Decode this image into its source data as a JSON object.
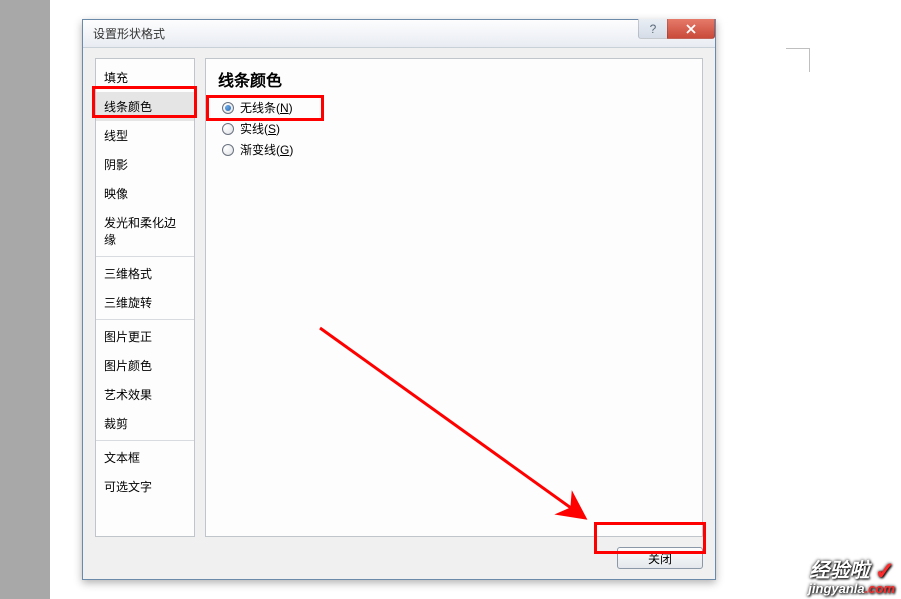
{
  "window": {
    "title": "设置形状格式"
  },
  "sidebar": {
    "items": [
      "填充",
      "线条颜色",
      "线型",
      "阴影",
      "映像",
      "发光和柔化边缘",
      "三维格式",
      "三维旋转",
      "图片更正",
      "图片颜色",
      "艺术效果",
      "裁剪",
      "文本框",
      "可选文字"
    ],
    "selected_index": 1,
    "separators_after": [
      5,
      7,
      11
    ]
  },
  "content": {
    "title": "线条颜色",
    "radios": [
      {
        "label": "无线条",
        "accel": "N",
        "checked": true
      },
      {
        "label": "实线",
        "accel": "S",
        "checked": false
      },
      {
        "label": "渐变线",
        "accel": "G",
        "checked": false
      }
    ]
  },
  "footer": {
    "close_label": "关闭"
  },
  "watermark": {
    "line1": "经验啦",
    "line2_prefix": "jingyanla",
    "line2_suffix": ".com"
  }
}
